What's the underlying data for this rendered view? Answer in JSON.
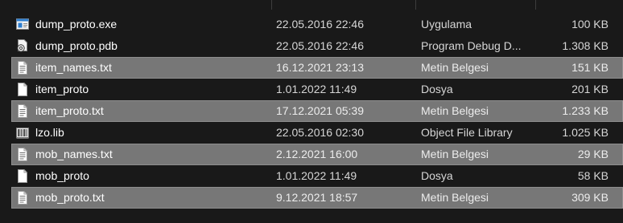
{
  "files": [
    {
      "name": "dump_proto.exe",
      "date": "22.05.2016 22:46",
      "type": "Uygulama",
      "size": "100 KB",
      "icon": "exe-icon",
      "selected": false
    },
    {
      "name": "dump_proto.pdb",
      "date": "22.05.2016 22:46",
      "type": "Program Debug D...",
      "size": "1.308 KB",
      "icon": "pdb-icon",
      "selected": false
    },
    {
      "name": "item_names.txt",
      "date": "16.12.2021 23:13",
      "type": "Metin Belgesi",
      "size": "151 KB",
      "icon": "text-file-icon",
      "selected": true
    },
    {
      "name": "item_proto",
      "date": "1.01.2022 11:49",
      "type": "Dosya",
      "size": "201 KB",
      "icon": "blank-file-icon",
      "selected": false
    },
    {
      "name": "item_proto.txt",
      "date": "17.12.2021 05:39",
      "type": "Metin Belgesi",
      "size": "1.233 KB",
      "icon": "text-file-icon",
      "selected": true
    },
    {
      "name": "lzo.lib",
      "date": "22.05.2016 02:30",
      "type": "Object File Library",
      "size": "1.025 KB",
      "icon": "lib-icon",
      "selected": false
    },
    {
      "name": "mob_names.txt",
      "date": "2.12.2021 16:00",
      "type": "Metin Belgesi",
      "size": "29 KB",
      "icon": "text-file-icon",
      "selected": true
    },
    {
      "name": "mob_proto",
      "date": "1.01.2022 11:49",
      "type": "Dosya",
      "size": "58 KB",
      "icon": "blank-file-icon",
      "selected": false
    },
    {
      "name": "mob_proto.txt",
      "date": "9.12.2021 18:57",
      "type": "Metin Belgesi",
      "size": "309 KB",
      "icon": "text-file-icon",
      "selected": true
    }
  ],
  "colors": {
    "background": "#191919",
    "selection": "#777777",
    "text": "#ffffff"
  }
}
